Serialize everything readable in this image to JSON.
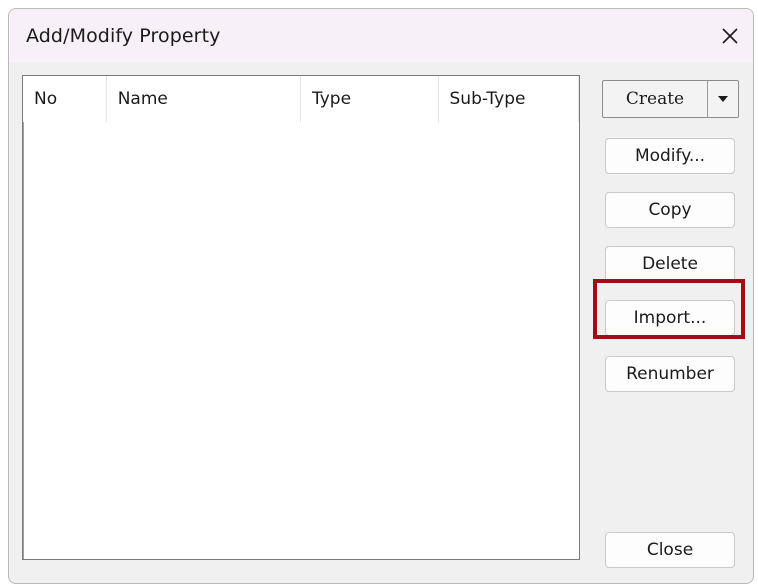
{
  "window": {
    "title": "Add/Modify Property"
  },
  "list": {
    "columns": [
      {
        "label": "No"
      },
      {
        "label": "Name"
      },
      {
        "label": "Type"
      },
      {
        "label": "Sub-Type"
      }
    ],
    "rows": []
  },
  "buttons": {
    "create": "Create",
    "modify": "Modify...",
    "copy": "Copy",
    "delete": "Delete",
    "import": "Import...",
    "renumber": "Renumber",
    "close": "Close"
  },
  "colors": {
    "highlight": "#a30c12",
    "title_bar": "#f8f0f8",
    "dialog_bg": "#f0f0f0"
  },
  "icons": {
    "close": "close-icon",
    "dropdown": "dropdown-arrow-icon"
  }
}
